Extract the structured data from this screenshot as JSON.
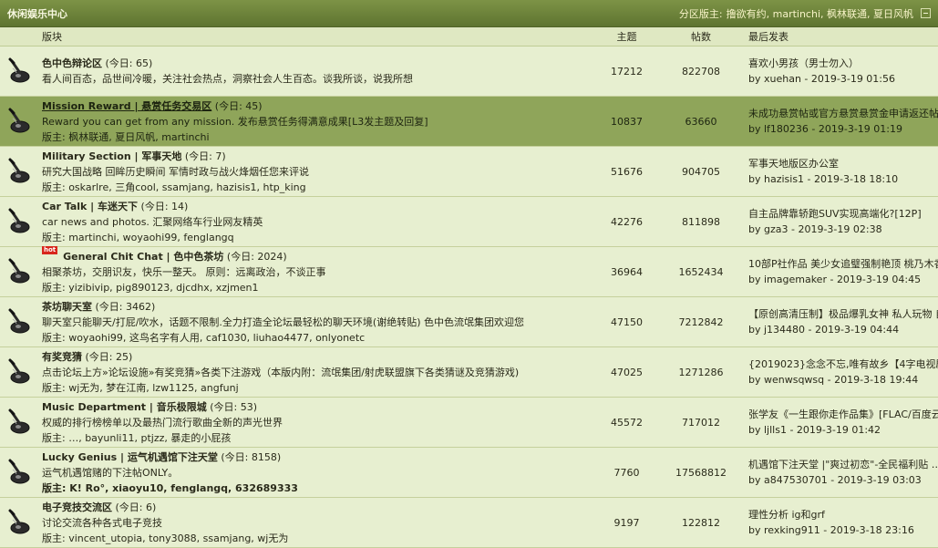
{
  "header": {
    "title": "休闲娱乐中心",
    "moderators_label": "分区版主:",
    "moderators": "撸欲有约, martinchi, 枫林联通, 夏日风帆"
  },
  "columns": {
    "forum": "版块",
    "topics": "主题",
    "posts": "帖数",
    "last_post": "最后发表"
  },
  "colors": {
    "header_bg": "#6b8138",
    "row_bg": "#e7efd0",
    "row_highlight_bg": "#8fa55a",
    "hot_badge": "#d8261c"
  },
  "forums": [
    {
      "name": "色中色辩论区",
      "today": "(今日: 65)",
      "desc": "看人间百态，品世间冷暖，关注社会热点，洞察社会人生百态。谈我所谈，说我所想",
      "mods": "",
      "topics": "17212",
      "posts": "822708",
      "last_title": "喜欢小男孩（男士勿入）",
      "last_meta": "by xuehan - 2019-3-19 01:56",
      "icon": "guitar-icon"
    },
    {
      "name": "Mission Reward | 悬赏任务交易区",
      "today": "(今日: 45)",
      "desc": "Reward you can get from any mission. 发布悬赏任务得满意成果[L3发主题及回复]",
      "mods": "版主: 枫林联通, 夏日风帆, martinchi",
      "topics": "10837",
      "posts": "63660",
      "last_title": "未成功悬赏帖或官方悬赏悬赏金申请返还帖",
      "last_meta": "by lf180236 - 2019-3-19 01:19",
      "icon": "guitar-icon"
    },
    {
      "name": "Military Section | 军事天地",
      "today": "(今日: 7)",
      "desc": "研究大国战略 回眸历史瞬间 军情时政与战火烽烟任您来评说",
      "mods": "版主: oskarlre, 三角cool, ssamjang, hazisis1, htp_king",
      "topics": "51676",
      "posts": "904705",
      "last_title": "军事天地版区办公室",
      "last_meta": "by hazisis1 - 2019-3-18 18:10",
      "icon": "guitar-icon"
    },
    {
      "name": "Car Talk | 车迷天下",
      "today": "(今日: 14)",
      "desc": "car news and photos. 汇聚网络车行业网友精英",
      "mods": "版主: martinchi, woyaohi99, fenglangq",
      "topics": "42276",
      "posts": "811898",
      "last_title": "自主品牌靠轿跑SUV实现高端化?[12P]",
      "last_meta": "by gza3 - 2019-3-19 02:38",
      "icon": "guitar-icon"
    },
    {
      "name": "General Chit Chat | 色中色茶坊",
      "today": "(今日: 2024)",
      "hot": "hot",
      "desc": "相聚茶坊，交朋识友，快乐一整天。 原则：远离政治，不谈正事",
      "mods": "版主: yizibivip, pig890123, djcdhx, xzjmen1",
      "topics": "36964",
      "posts": "1652434",
      "last_title": "10部P社作品 美少女追璧强制艳顶 桃乃木香…",
      "last_meta": "by imagemaker - 2019-3-19 04:45",
      "icon": "guitar-icon"
    },
    {
      "name": "茶坊聊天室",
      "today": "(今日: 3462)",
      "desc": "聊天室只能聊天/打屁/吹水，话题不限制.全力打造全论坛最轻松的聊天环境(谢绝转贴) 色中色流氓集团欢迎您",
      "mods": "版主: woyaohi99, 这鸟名字有人用, caf1030, liuhao4477, onlyonetc",
      "topics": "47150",
      "posts": "7212842",
      "last_title": "【原创高清压制】极品爆乳女神 私人玩物 自 …",
      "last_meta": "by j134480 - 2019-3-19 04:44",
      "icon": "guitar-icon"
    },
    {
      "name": "有奖竞猜",
      "today": "(今日: 25)",
      "desc": "点击论坛上方»论坛设施»有奖竞猜»各类下注游戏（本版内附：流氓集团/射虎联盟旗下各类猜谜及竞猜游戏)",
      "mods": "版主: wj无为, 梦在江南, lzw1125, angfunj",
      "topics": "47025",
      "posts": "1271286",
      "last_title": "{2019023}念念不忘,唯有故乡【4字电视剧】",
      "last_meta": "by wenwsqwsq - 2019-3-18 19:44",
      "icon": "guitar-icon"
    },
    {
      "name": "Music Department | 音乐极限城",
      "today": "(今日: 53)",
      "desc": "权威的排行榜榜单以及最热门流行歌曲全新的声光世界",
      "mods": "版主: …, bayunli11, ptjzz, 暴走的小屁孩",
      "topics": "45572",
      "posts": "717012",
      "last_title": "张学友《一生跟你走作品集》[FLAC/百度云]",
      "last_meta": "by ljlls1 - 2019-3-19 01:42",
      "icon": "guitar-icon"
    },
    {
      "name": "Lucky Genius | 运气机遇馆下注天堂",
      "today": "(今日: 8158)",
      "desc": "运气机遇馆赌的下注帖ONLY。",
      "mods": "版主: K! Ro°, xiaoyu10, fenglangq, 632689333",
      "bold_mods": true,
      "topics": "7760",
      "posts": "17568812",
      "last_title": "机遇馆下注天堂 |\"爽过初恋\"-全民福利贴 …",
      "last_meta": "by a847530701 - 2019-3-19 03:03",
      "icon": "guitar-icon"
    },
    {
      "name": "电子竞技交流区",
      "today": "(今日: 6)",
      "desc": "讨论交流各种各式电子竞技",
      "mods": "版主: vincent_utopia, tony3088, ssamjang, wj无为",
      "topics": "9197",
      "posts": "122812",
      "last_title": "理性分析 ig和grf",
      "last_meta": "by rexking911 - 2019-3-18 23:16",
      "icon": "guitar-icon"
    }
  ]
}
